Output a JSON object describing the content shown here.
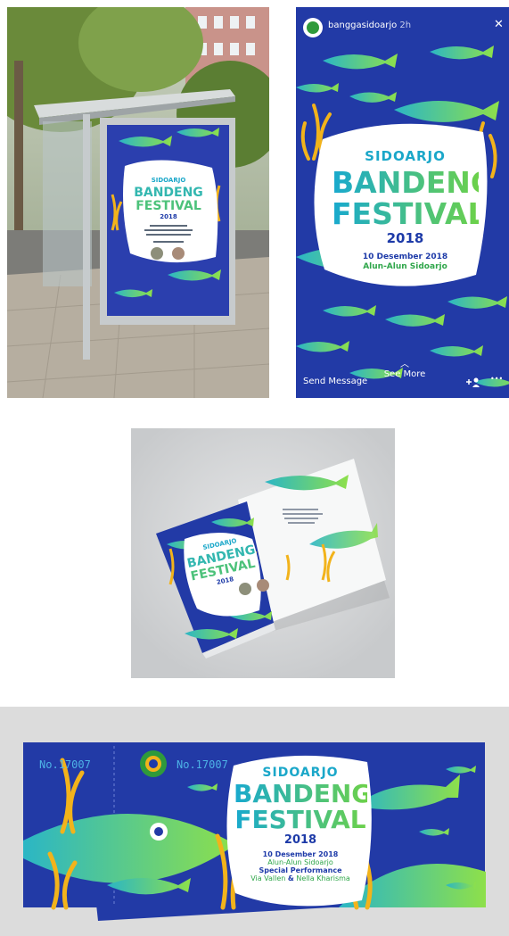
{
  "colors": {
    "navy": "#223aa6",
    "fish_start": "#2bb6c5",
    "fish_end": "#8ee04a",
    "weed": "#f2b31b",
    "bg_grey": "#d4d6d8"
  },
  "event": {
    "city": "SIDOARJO",
    "name_1": "BANDENG",
    "name_2": "FESTIVAL",
    "year": "2018",
    "date": "10 Desember 2018",
    "venue": "Alun-Alun Sidoarjo",
    "special": "Special Performance",
    "performers_a": "Via Vallen",
    "performers_amp": "&",
    "performers_b": "Nella Kharisma"
  },
  "story": {
    "username": "banggasidoarjo",
    "time": "2h",
    "close_glyph": "✕",
    "send_message": "Send Message",
    "see_more": "See More",
    "more_glyph": "•••"
  },
  "ticket": {
    "number_left": "No.17007",
    "number_right": "No.17007"
  }
}
